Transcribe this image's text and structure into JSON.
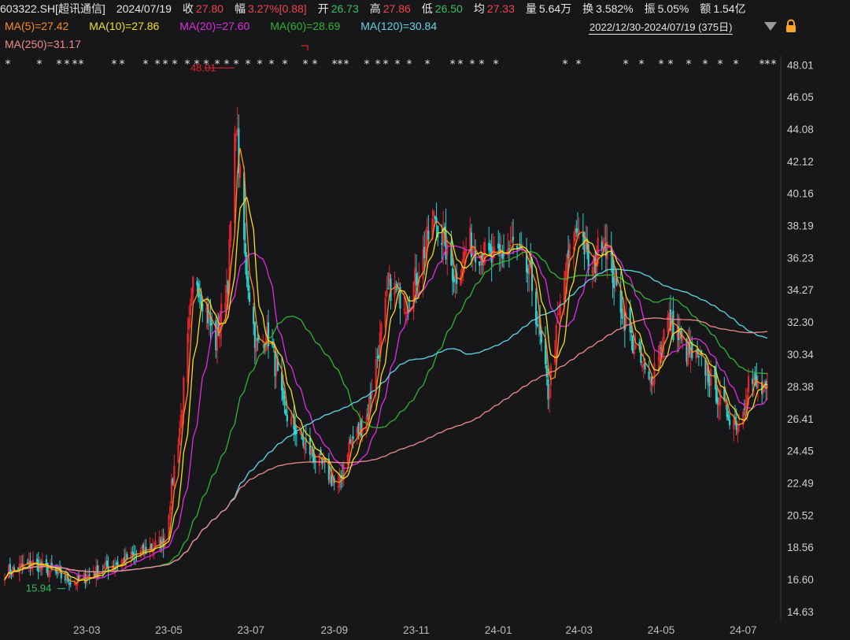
{
  "header": {
    "code": "603322.SH[超讯通信]",
    "date": "2024/07/19",
    "close_label": "收",
    "close": "27.80",
    "change_label": "幅",
    "change": "3.27%[0.88]",
    "open_label": "开",
    "open": "26.73",
    "high_label": "高",
    "high": "27.86",
    "low_label": "低",
    "low": "26.50",
    "avg_label": "均",
    "avg": "27.33",
    "volume_label": "量",
    "volume": "5.64万",
    "turnover_label": "换",
    "turnover": "3.582%",
    "amplitude_label": "振",
    "amplitude": "5.05%",
    "amount_label": "额",
    "amount": "1.54亿"
  },
  "moving_averages": [
    {
      "label": "MA(5)=27.42",
      "color": "#ff8c1a"
    },
    {
      "label": "MA(10)=27.86",
      "color": "#f2e11a"
    },
    {
      "label": "MA(20)=27.60",
      "color": "#e02ce0"
    },
    {
      "label": "MA(60)=28.69",
      "color": "#2fb52f"
    },
    {
      "label": "MA(120)=30.84",
      "color": "#5fd8e8"
    },
    {
      "label": "MA(250)=31.17",
      "color": "#f08a8a"
    }
  ],
  "range": "2022/12/30-2024/07/19 (375日)",
  "icons": {
    "range_menu": "triangle-down-icon",
    "lock": "lock-icon"
  },
  "colors": {
    "background": "#17171a",
    "up": "#e0262e",
    "down": "#2ed1d1",
    "axis_text": "#cfcfcf"
  },
  "chart_data": {
    "type": "candlestick",
    "ylim": [
      14.0,
      48.6
    ],
    "y_ticks": [
      "48.01",
      "46.05",
      "44.08",
      "42.12",
      "40.16",
      "38.19",
      "36.23",
      "34.27",
      "32.30",
      "30.34",
      "28.38",
      "26.41",
      "24.45",
      "22.49",
      "20.52",
      "18.56",
      "16.60",
      "14.63"
    ],
    "x_ticks": [
      "23-03",
      "23-05",
      "23-07",
      "23-09",
      "23-11",
      "24-01",
      "24-03",
      "24-05",
      "24-07"
    ],
    "annotations": [
      {
        "text": "48.01",
        "kind": "max",
        "value": 48.01,
        "date": "2023-06-20"
      },
      {
        "text": "15.94",
        "kind": "min",
        "value": 15.94,
        "date": "2023-02-20"
      }
    ],
    "price_keypoints": [
      [
        "2022-12-30",
        17.0
      ],
      [
        "2023-01-20",
        17.6
      ],
      [
        "2023-02-20",
        16.4
      ],
      [
        "2023-03-15",
        17.3
      ],
      [
        "2023-04-10",
        18.2
      ],
      [
        "2023-04-28",
        19.0
      ],
      [
        "2023-05-10",
        26.5
      ],
      [
        "2023-05-20",
        35.5
      ],
      [
        "2023-06-05",
        31.0
      ],
      [
        "2023-06-14",
        35.0
      ],
      [
        "2023-06-20",
        44.5
      ],
      [
        "2023-06-27",
        36.0
      ],
      [
        "2023-07-05",
        30.8
      ],
      [
        "2023-07-15",
        31.5
      ],
      [
        "2023-07-25",
        27.0
      ],
      [
        "2023-08-10",
        24.8
      ],
      [
        "2023-08-28",
        23.0
      ],
      [
        "2023-09-04",
        22.0
      ],
      [
        "2023-09-10",
        24.5
      ],
      [
        "2023-09-25",
        26.5
      ],
      [
        "2023-10-12",
        34.5
      ],
      [
        "2023-10-26",
        33.5
      ],
      [
        "2023-11-15",
        38.8
      ],
      [
        "2023-11-30",
        35.0
      ],
      [
        "2023-12-10",
        37.2
      ],
      [
        "2023-12-28",
        36.0
      ],
      [
        "2024-01-12",
        37.0
      ],
      [
        "2024-01-25",
        35.0
      ],
      [
        "2024-02-07",
        28.0
      ],
      [
        "2024-02-20",
        35.5
      ],
      [
        "2024-03-01",
        38.5
      ],
      [
        "2024-03-10",
        35.0
      ],
      [
        "2024-03-19",
        38.0
      ],
      [
        "2024-03-28",
        34.5
      ],
      [
        "2024-04-10",
        31.0
      ],
      [
        "2024-04-22",
        28.5
      ],
      [
        "2024-05-06",
        32.5
      ],
      [
        "2024-05-20",
        30.5
      ],
      [
        "2024-06-03",
        29.5
      ],
      [
        "2024-06-17",
        27.0
      ],
      [
        "2024-06-28",
        26.0
      ],
      [
        "2024-07-05",
        28.8
      ],
      [
        "2024-07-19",
        27.8
      ]
    ],
    "ma_series": [
      {
        "name": "MA(20)",
        "period": 20,
        "color": "#e02ce0"
      },
      {
        "name": "MA(60)",
        "period": 60,
        "color": "#2fb52f"
      },
      {
        "name": "MA(120)",
        "period": 120,
        "color": "#5fd8e8"
      },
      {
        "name": "MA(250)",
        "period": 250,
        "color": "#f08a8a"
      }
    ],
    "short_ma_series": [
      {
        "name": "MA(5)",
        "period": 5,
        "color": "#ff8c1a"
      },
      {
        "name": "MA(10)",
        "period": 10,
        "color": "#f2e11a"
      }
    ]
  }
}
